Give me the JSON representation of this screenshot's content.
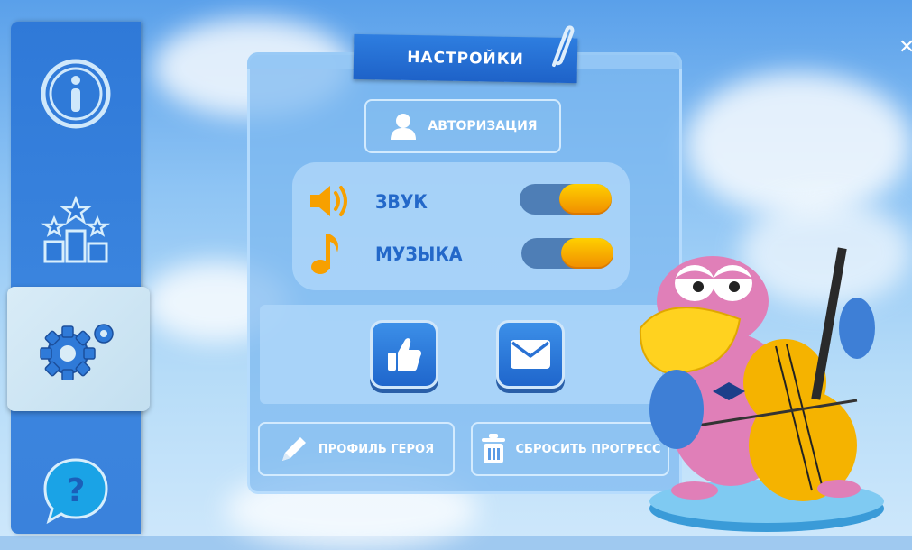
{
  "settings": {
    "title": "НАСТРОЙКИ",
    "auth_label": "АВТОРИЗАЦИЯ",
    "sound_label": "ЗВУК",
    "music_label": "МУЗЫКА",
    "sound_on": true,
    "music_on": true,
    "hero_profile_label": "ПРОФИЛЬ ГЕРОЯ",
    "reset_progress_label": "СБРОСИТЬ ПРОГРЕСС"
  },
  "sidebar": {
    "items": [
      {
        "icon": "info-icon"
      },
      {
        "icon": "leaderboard-icon"
      },
      {
        "icon": "gear-icon",
        "active": true
      },
      {
        "icon": "help-icon"
      }
    ]
  },
  "icons": {
    "auth": "user-icon",
    "sound": "speaker-icon",
    "music": "music-note-icon",
    "like": "thumbs-up-icon",
    "mail": "mail-icon",
    "profile": "pencil-icon",
    "reset": "trash-icon",
    "close": "close-icon"
  },
  "colors": {
    "accent_blue": "#2368c9",
    "toggle_on": "#f7a800",
    "panel": "#7db9f0"
  }
}
